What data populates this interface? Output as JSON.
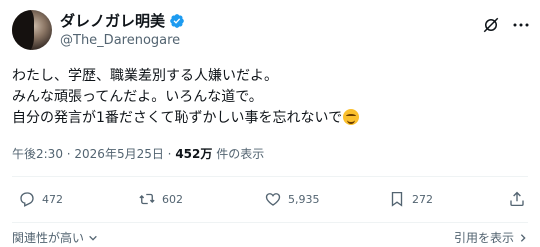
{
  "user": {
    "display_name": "ダレノガレ明美",
    "handle": "@The_Darenogare"
  },
  "tweet": {
    "lines": [
      "わたし、学歴、職業差別する人嫌いだよ。",
      "みんな頑張ってんだよ。いろんな道で。",
      "自分の発言が1番ださくて恥ずかしい事を忘れないで"
    ]
  },
  "meta": {
    "time": "午後2:30",
    "sep1": " · ",
    "date": "2026年5月25日",
    "sep2": " · ",
    "views_count": "452万",
    "views_label": " 件の表示"
  },
  "actions": {
    "replies": "472",
    "reposts": "602",
    "likes": "5,935",
    "bookmarks": "272"
  },
  "footer": {
    "sort_label": "関連性が高い",
    "quotes_link": "引用を表示"
  },
  "colors": {
    "verified": "#1d9bf0",
    "text": "#0f1419",
    "muted": "#536471"
  }
}
